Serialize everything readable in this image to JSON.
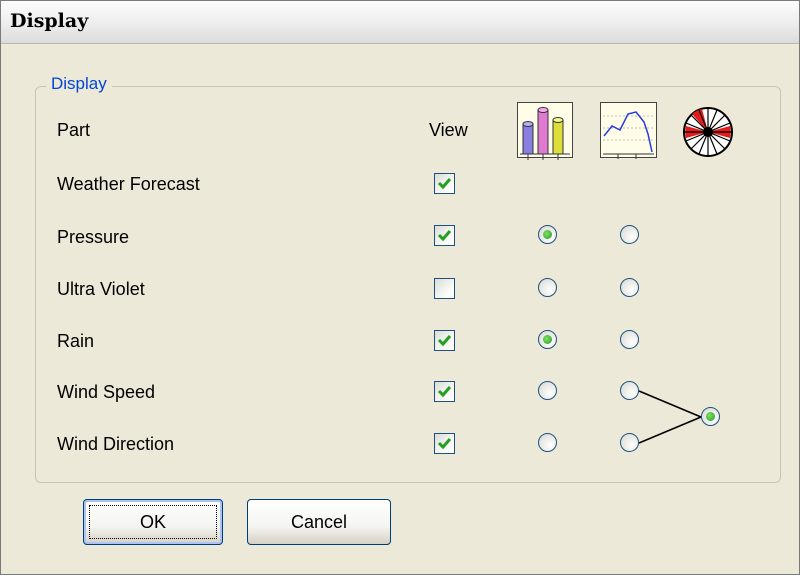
{
  "window": {
    "title": "Display"
  },
  "group": {
    "label": "Display"
  },
  "columns": {
    "part": "Part",
    "view": "View",
    "icons": [
      "bar-chart-icon",
      "line-chart-icon",
      "wind-rose-icon"
    ]
  },
  "rows": [
    {
      "label": "Weather Forecast",
      "view": true,
      "radio1": null,
      "radio2": null
    },
    {
      "label": "Pressure",
      "view": true,
      "radio1": true,
      "radio2": false
    },
    {
      "label": "Ultra Violet",
      "view": false,
      "radio1": false,
      "radio2": false
    },
    {
      "label": "Rain",
      "view": true,
      "radio1": true,
      "radio2": false
    },
    {
      "label": "Wind Speed",
      "view": true,
      "radio1": false,
      "radio2": false
    },
    {
      "label": "Wind Direction",
      "view": true,
      "radio1": false,
      "radio2": false
    }
  ],
  "wind_combined": {
    "selected": true
  },
  "buttons": {
    "ok": "OK",
    "cancel": "Cancel"
  },
  "colors": {
    "accent_blue": "#0046d5",
    "check_green": "#21a121",
    "border_blue": "#1c5180"
  }
}
